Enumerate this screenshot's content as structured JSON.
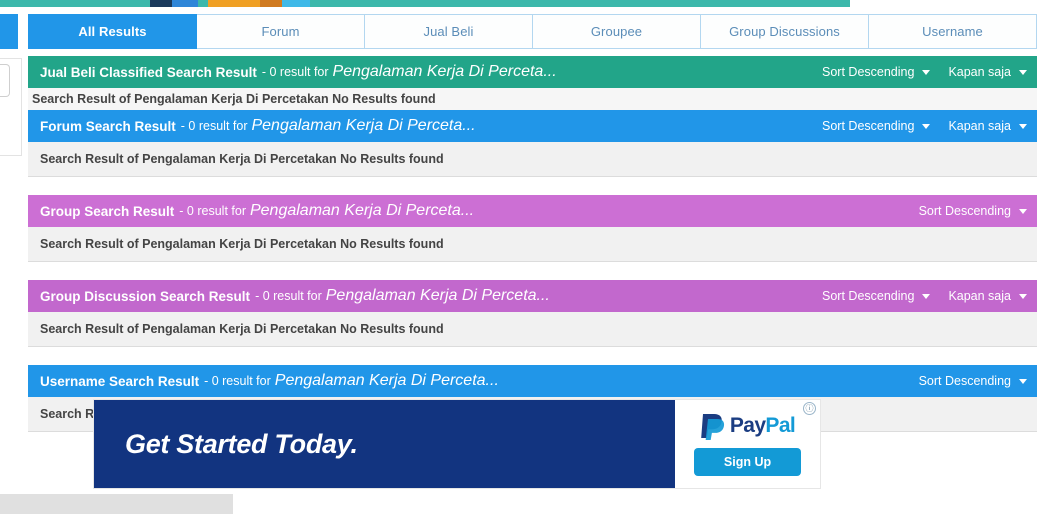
{
  "tabs": [
    {
      "label": "All Results",
      "active": true
    },
    {
      "label": "Forum",
      "active": false
    },
    {
      "label": "Jual Beli",
      "active": false
    },
    {
      "label": "Groupee",
      "active": false
    },
    {
      "label": "Group Discussions",
      "active": false
    },
    {
      "label": "Username",
      "active": false
    }
  ],
  "colors": {
    "teal": "#22a589",
    "blue": "#2196e8",
    "purple": "#cc6fd4",
    "purple_alt": "#c268cd",
    "tab_active": "#2196e8",
    "tab_text": "#5b8db8",
    "ad_navy": "#123480",
    "ad_cyan": "#139ad6"
  },
  "blocks": [
    {
      "title": "Jual Beli Classified Search Result",
      "meta": "- 0 result for",
      "term": "Pengalaman Kerja Di Perceta...",
      "header_color": "#22a589",
      "body": "Search Result of Pengalaman Kerja Di Percetakan No Results found",
      "controls": [
        {
          "label": "Sort Descending"
        },
        {
          "label": "Kapan saja"
        }
      ]
    },
    {
      "title": "Forum Search Result",
      "meta": "- 0 result for",
      "term": "Pengalaman Kerja Di Perceta...",
      "header_color": "#2196e8",
      "body": "Search Result of Pengalaman Kerja Di Percetakan No Results found",
      "controls": [
        {
          "label": "Sort Descending"
        },
        {
          "label": "Kapan saja"
        }
      ]
    },
    {
      "title": "Group Search Result",
      "meta": "- 0 result for",
      "term": "Pengalaman Kerja Di Perceta...",
      "header_color": "#cc6fd4",
      "body": "Search Result of Pengalaman Kerja Di Percetakan No Results found",
      "controls": [
        {
          "label": "Sort Descending"
        }
      ]
    },
    {
      "title": "Group Discussion Search Result",
      "meta": "- 0 result for",
      "term": "Pengalaman Kerja Di Perceta...",
      "header_color": "#c268cd",
      "body": "Search Result of Pengalaman Kerja Di Percetakan No Results found",
      "controls": [
        {
          "label": "Sort Descending"
        },
        {
          "label": "Kapan saja"
        }
      ]
    },
    {
      "title": "Username Search Result",
      "meta": "- 0 result for",
      "term": "Pengalaman Kerja Di Perceta...",
      "header_color": "#2196e8",
      "body": "Search Result of Pengalaman Kerja Di Percetakan No Results found",
      "controls": [
        {
          "label": "Sort Descending"
        }
      ]
    }
  ],
  "ad": {
    "headline": "Get Started Today.",
    "brand_pay": "Pay",
    "brand_pal": "Pal",
    "cta": "Sign Up",
    "info_glyph": "ⓘ"
  }
}
